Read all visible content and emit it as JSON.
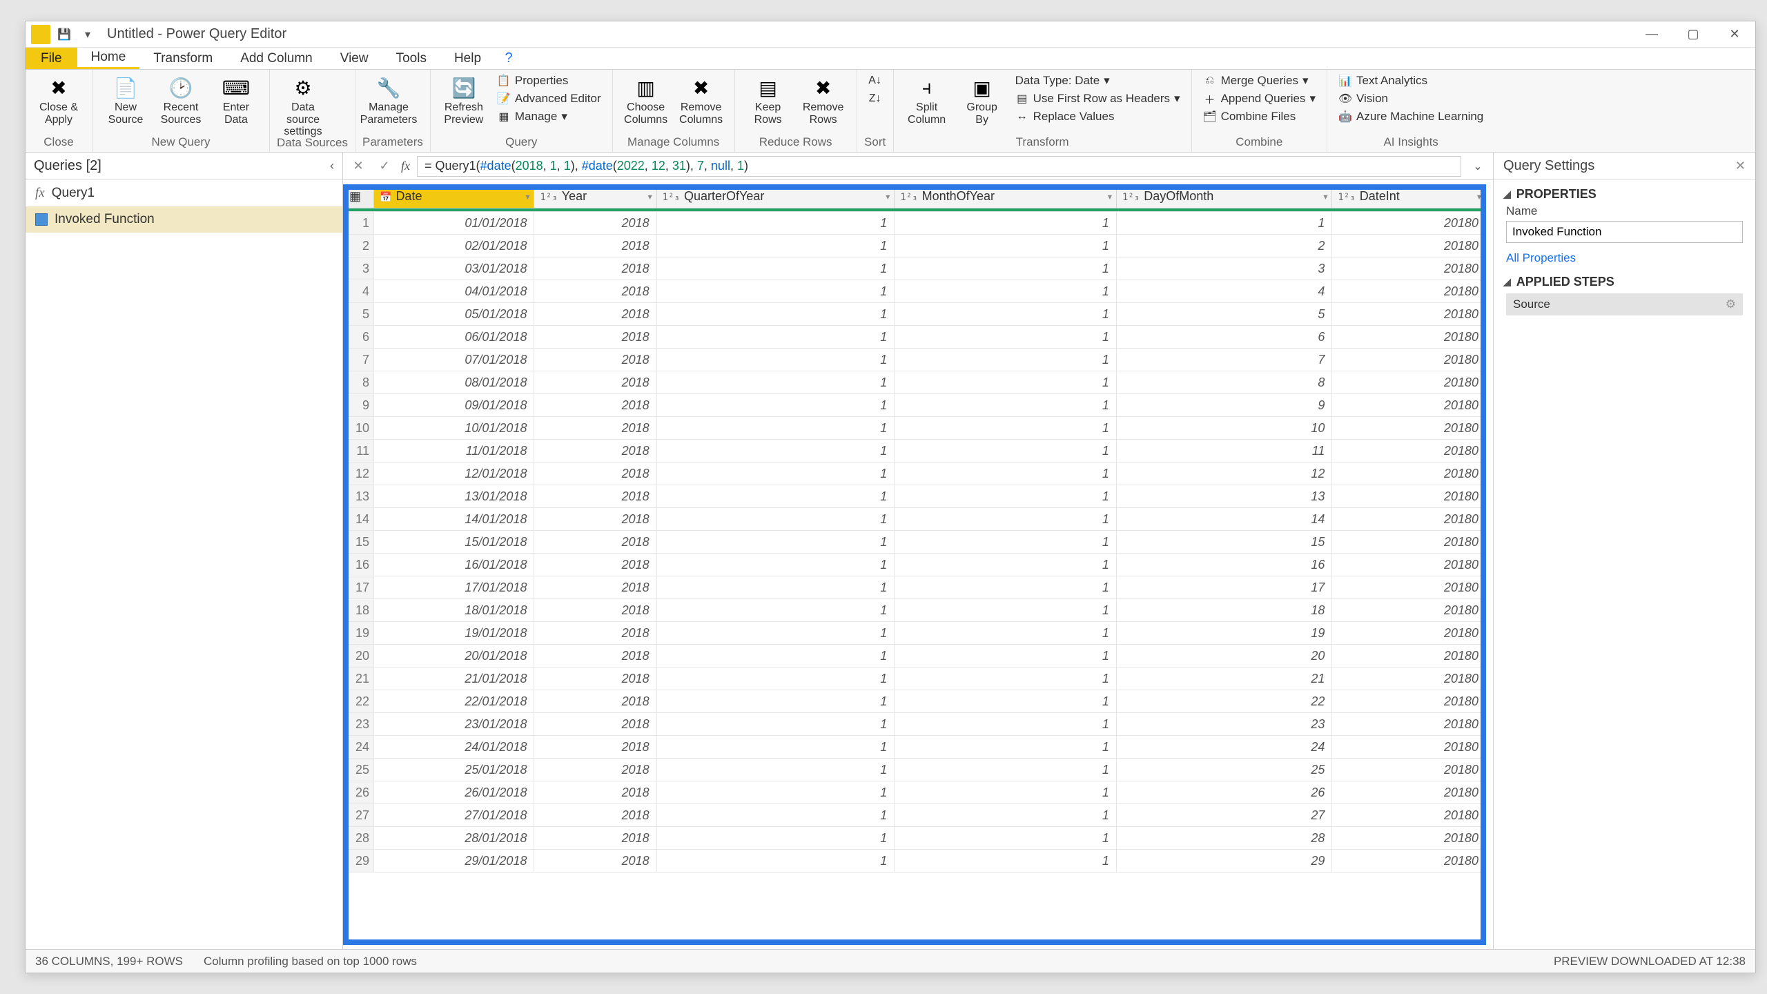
{
  "window": {
    "title": "Untitled - Power Query Editor"
  },
  "menu": {
    "file": "File",
    "tabs": [
      "Home",
      "Transform",
      "Add Column",
      "View",
      "Tools",
      "Help"
    ],
    "active": "Home"
  },
  "ribbon": {
    "close": {
      "close_apply": "Close &\nApply",
      "group": "Close"
    },
    "newquery": {
      "new_source": "New\nSource",
      "recent_sources": "Recent\nSources",
      "enter_data": "Enter\nData",
      "group": "New Query"
    },
    "datasources": {
      "settings": "Data source\nsettings",
      "group": "Data Sources"
    },
    "parameters": {
      "manage": "Manage\nParameters",
      "group": "Parameters"
    },
    "query": {
      "refresh": "Refresh\nPreview",
      "properties": "Properties",
      "advanced": "Advanced Editor",
      "manage": "Manage",
      "group": "Query"
    },
    "managecols": {
      "choose": "Choose\nColumns",
      "remove": "Remove\nColumns",
      "group": "Manage Columns"
    },
    "reducerows": {
      "keep": "Keep\nRows",
      "remove": "Remove\nRows",
      "group": "Reduce Rows"
    },
    "sort": {
      "group": "Sort"
    },
    "transform": {
      "split": "Split\nColumn",
      "group_by": "Group\nBy",
      "datatype": "Data Type: Date",
      "firstrow": "Use First Row as Headers",
      "replace": "Replace Values",
      "group": "Transform"
    },
    "combine": {
      "merge": "Merge Queries",
      "append": "Append Queries",
      "combine": "Combine Files",
      "group": "Combine"
    },
    "ai": {
      "text": "Text Analytics",
      "vision": "Vision",
      "ml": "Azure Machine Learning",
      "group": "AI Insights"
    }
  },
  "queries": {
    "title": "Queries [2]",
    "items": [
      {
        "name": "Query1",
        "type": "fx"
      },
      {
        "name": "Invoked Function",
        "type": "table",
        "selected": true
      }
    ]
  },
  "formula": "= Query1(#date(2018, 1, 1), #date(2022, 12, 31), 7, null, 1)",
  "columns": [
    {
      "name": "Date",
      "type": "📅",
      "selected": true
    },
    {
      "name": "Year",
      "type": "1²₃"
    },
    {
      "name": "QuarterOfYear",
      "type": "1²₃"
    },
    {
      "name": "MonthOfYear",
      "type": "1²₃"
    },
    {
      "name": "DayOfMonth",
      "type": "1²₃"
    },
    {
      "name": "DateInt",
      "type": "1²₃"
    }
  ],
  "rows": [
    {
      "n": 1,
      "Date": "01/01/2018",
      "Year": "2018",
      "QuarterOfYear": "1",
      "MonthOfYear": "1",
      "DayOfMonth": "1",
      "DateInt": "20180"
    },
    {
      "n": 2,
      "Date": "02/01/2018",
      "Year": "2018",
      "QuarterOfYear": "1",
      "MonthOfYear": "1",
      "DayOfMonth": "2",
      "DateInt": "20180"
    },
    {
      "n": 3,
      "Date": "03/01/2018",
      "Year": "2018",
      "QuarterOfYear": "1",
      "MonthOfYear": "1",
      "DayOfMonth": "3",
      "DateInt": "20180"
    },
    {
      "n": 4,
      "Date": "04/01/2018",
      "Year": "2018",
      "QuarterOfYear": "1",
      "MonthOfYear": "1",
      "DayOfMonth": "4",
      "DateInt": "20180"
    },
    {
      "n": 5,
      "Date": "05/01/2018",
      "Year": "2018",
      "QuarterOfYear": "1",
      "MonthOfYear": "1",
      "DayOfMonth": "5",
      "DateInt": "20180"
    },
    {
      "n": 6,
      "Date": "06/01/2018",
      "Year": "2018",
      "QuarterOfYear": "1",
      "MonthOfYear": "1",
      "DayOfMonth": "6",
      "DateInt": "20180"
    },
    {
      "n": 7,
      "Date": "07/01/2018",
      "Year": "2018",
      "QuarterOfYear": "1",
      "MonthOfYear": "1",
      "DayOfMonth": "7",
      "DateInt": "20180"
    },
    {
      "n": 8,
      "Date": "08/01/2018",
      "Year": "2018",
      "QuarterOfYear": "1",
      "MonthOfYear": "1",
      "DayOfMonth": "8",
      "DateInt": "20180"
    },
    {
      "n": 9,
      "Date": "09/01/2018",
      "Year": "2018",
      "QuarterOfYear": "1",
      "MonthOfYear": "1",
      "DayOfMonth": "9",
      "DateInt": "20180"
    },
    {
      "n": 10,
      "Date": "10/01/2018",
      "Year": "2018",
      "QuarterOfYear": "1",
      "MonthOfYear": "1",
      "DayOfMonth": "10",
      "DateInt": "20180"
    },
    {
      "n": 11,
      "Date": "11/01/2018",
      "Year": "2018",
      "QuarterOfYear": "1",
      "MonthOfYear": "1",
      "DayOfMonth": "11",
      "DateInt": "20180"
    },
    {
      "n": 12,
      "Date": "12/01/2018",
      "Year": "2018",
      "QuarterOfYear": "1",
      "MonthOfYear": "1",
      "DayOfMonth": "12",
      "DateInt": "20180"
    },
    {
      "n": 13,
      "Date": "13/01/2018",
      "Year": "2018",
      "QuarterOfYear": "1",
      "MonthOfYear": "1",
      "DayOfMonth": "13",
      "DateInt": "20180"
    },
    {
      "n": 14,
      "Date": "14/01/2018",
      "Year": "2018",
      "QuarterOfYear": "1",
      "MonthOfYear": "1",
      "DayOfMonth": "14",
      "DateInt": "20180"
    },
    {
      "n": 15,
      "Date": "15/01/2018",
      "Year": "2018",
      "QuarterOfYear": "1",
      "MonthOfYear": "1",
      "DayOfMonth": "15",
      "DateInt": "20180"
    },
    {
      "n": 16,
      "Date": "16/01/2018",
      "Year": "2018",
      "QuarterOfYear": "1",
      "MonthOfYear": "1",
      "DayOfMonth": "16",
      "DateInt": "20180"
    },
    {
      "n": 17,
      "Date": "17/01/2018",
      "Year": "2018",
      "QuarterOfYear": "1",
      "MonthOfYear": "1",
      "DayOfMonth": "17",
      "DateInt": "20180"
    },
    {
      "n": 18,
      "Date": "18/01/2018",
      "Year": "2018",
      "QuarterOfYear": "1",
      "MonthOfYear": "1",
      "DayOfMonth": "18",
      "DateInt": "20180"
    },
    {
      "n": 19,
      "Date": "19/01/2018",
      "Year": "2018",
      "QuarterOfYear": "1",
      "MonthOfYear": "1",
      "DayOfMonth": "19",
      "DateInt": "20180"
    },
    {
      "n": 20,
      "Date": "20/01/2018",
      "Year": "2018",
      "QuarterOfYear": "1",
      "MonthOfYear": "1",
      "DayOfMonth": "20",
      "DateInt": "20180"
    },
    {
      "n": 21,
      "Date": "21/01/2018",
      "Year": "2018",
      "QuarterOfYear": "1",
      "MonthOfYear": "1",
      "DayOfMonth": "21",
      "DateInt": "20180"
    },
    {
      "n": 22,
      "Date": "22/01/2018",
      "Year": "2018",
      "QuarterOfYear": "1",
      "MonthOfYear": "1",
      "DayOfMonth": "22",
      "DateInt": "20180"
    },
    {
      "n": 23,
      "Date": "23/01/2018",
      "Year": "2018",
      "QuarterOfYear": "1",
      "MonthOfYear": "1",
      "DayOfMonth": "23",
      "DateInt": "20180"
    },
    {
      "n": 24,
      "Date": "24/01/2018",
      "Year": "2018",
      "QuarterOfYear": "1",
      "MonthOfYear": "1",
      "DayOfMonth": "24",
      "DateInt": "20180"
    },
    {
      "n": 25,
      "Date": "25/01/2018",
      "Year": "2018",
      "QuarterOfYear": "1",
      "MonthOfYear": "1",
      "DayOfMonth": "25",
      "DateInt": "20180"
    },
    {
      "n": 26,
      "Date": "26/01/2018",
      "Year": "2018",
      "QuarterOfYear": "1",
      "MonthOfYear": "1",
      "DayOfMonth": "26",
      "DateInt": "20180"
    },
    {
      "n": 27,
      "Date": "27/01/2018",
      "Year": "2018",
      "QuarterOfYear": "1",
      "MonthOfYear": "1",
      "DayOfMonth": "27",
      "DateInt": "20180"
    },
    {
      "n": 28,
      "Date": "28/01/2018",
      "Year": "2018",
      "QuarterOfYear": "1",
      "MonthOfYear": "1",
      "DayOfMonth": "28",
      "DateInt": "20180"
    },
    {
      "n": 29,
      "Date": "29/01/2018",
      "Year": "2018",
      "QuarterOfYear": "1",
      "MonthOfYear": "1",
      "DayOfMonth": "29",
      "DateInt": "20180"
    }
  ],
  "settings": {
    "title": "Query Settings",
    "properties": "PROPERTIES",
    "name_label": "Name",
    "name_value": "Invoked Function",
    "all_props": "All Properties",
    "applied": "APPLIED STEPS",
    "steps": [
      "Source"
    ]
  },
  "status": {
    "left": "36 COLUMNS, 199+ ROWS",
    "mid": "Column profiling based on top 1000 rows",
    "right": "PREVIEW DOWNLOADED AT 12:38"
  }
}
